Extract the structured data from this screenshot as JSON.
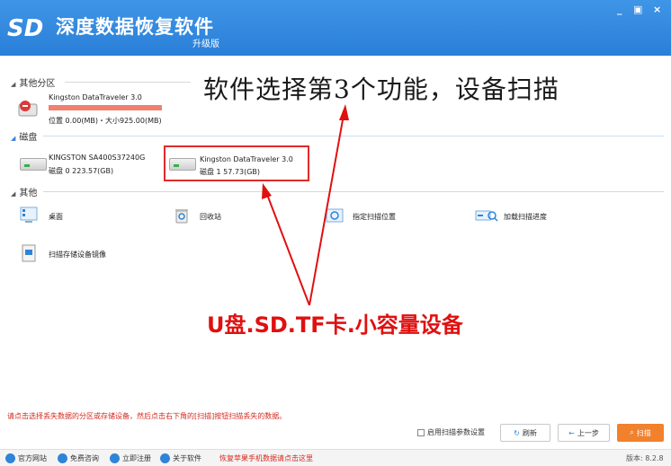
{
  "header": {
    "title": "深度数据恢复软件",
    "subtitle": "升级版",
    "win_minimize": "_",
    "win_restore": "▣",
    "win_close": "×",
    "accent": "#2f84d8"
  },
  "sections": {
    "other_partition": {
      "label": "其他分区"
    },
    "disk": {
      "label": "磁盘"
    },
    "other": {
      "label": "其他"
    }
  },
  "partitions": [
    {
      "name": "Kingston DataTraveler 3.0",
      "detail": "位置 0.00(MB)・大小925.00(MB)"
    }
  ],
  "disks": [
    {
      "name": "KINGSTON SA400S37240G",
      "detail": "磁盘 0    223.57(GB)"
    },
    {
      "name": "Kingston DataTraveler 3.0",
      "detail": "磁盘 1    57.73(GB)"
    }
  ],
  "others": [
    {
      "label": "桌面",
      "icon": "desktop-icon"
    },
    {
      "label": "回收站",
      "icon": "recycle-bin-icon"
    },
    {
      "label": "指定扫描位置",
      "icon": "target-folder-icon"
    },
    {
      "label": "加载扫描进度",
      "icon": "load-progress-icon"
    },
    {
      "label": "扫描存储设备镜像",
      "icon": "disk-image-icon"
    }
  ],
  "annotations": {
    "title": "软件选择第3个功能，设备扫描",
    "red_text": "U盘.SD.TF卡.小容量设备"
  },
  "bottom": {
    "hint": "请点击选择丢失数据的分区或存储设备，然后点击右下角的[扫描]按钮扫描丢失的数据。",
    "checkbox_label": "启用扫描参数设置",
    "refresh": "刷新",
    "prev": "上一步",
    "scan": "扫描",
    "scan_color": "#f1812c"
  },
  "footer": {
    "items": [
      "官方网站",
      "免费咨询",
      "立即注册",
      "关于软件"
    ],
    "promo": "恢复苹果手机数据请点击这里",
    "version": "版本: 8.2.8"
  }
}
